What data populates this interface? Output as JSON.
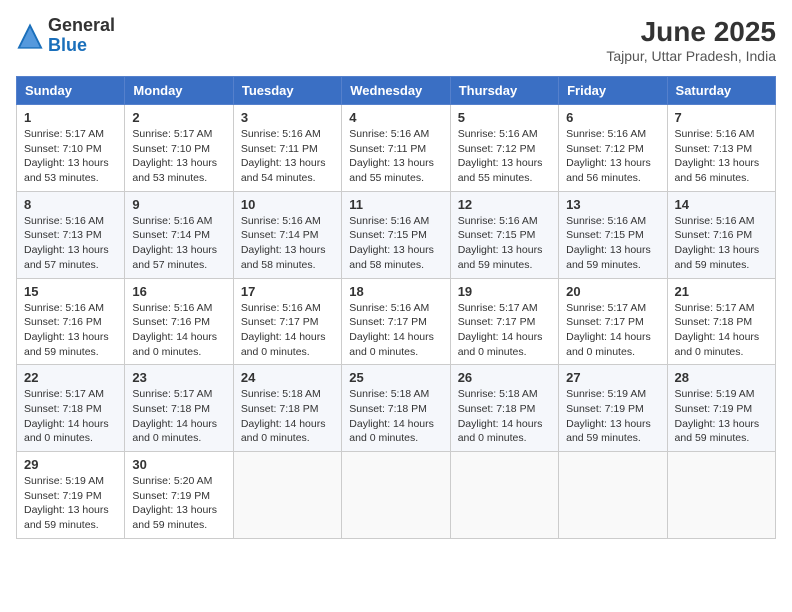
{
  "header": {
    "logo_general": "General",
    "logo_blue": "Blue",
    "month_year": "June 2025",
    "location": "Tajpur, Uttar Pradesh, India"
  },
  "days_of_week": [
    "Sunday",
    "Monday",
    "Tuesday",
    "Wednesday",
    "Thursday",
    "Friday",
    "Saturday"
  ],
  "weeks": [
    [
      {
        "day": "1",
        "lines": [
          "Sunrise: 5:17 AM",
          "Sunset: 7:10 PM",
          "Daylight: 13 hours",
          "and 53 minutes."
        ]
      },
      {
        "day": "2",
        "lines": [
          "Sunrise: 5:17 AM",
          "Sunset: 7:10 PM",
          "Daylight: 13 hours",
          "and 53 minutes."
        ]
      },
      {
        "day": "3",
        "lines": [
          "Sunrise: 5:16 AM",
          "Sunset: 7:11 PM",
          "Daylight: 13 hours",
          "and 54 minutes."
        ]
      },
      {
        "day": "4",
        "lines": [
          "Sunrise: 5:16 AM",
          "Sunset: 7:11 PM",
          "Daylight: 13 hours",
          "and 55 minutes."
        ]
      },
      {
        "day": "5",
        "lines": [
          "Sunrise: 5:16 AM",
          "Sunset: 7:12 PM",
          "Daylight: 13 hours",
          "and 55 minutes."
        ]
      },
      {
        "day": "6",
        "lines": [
          "Sunrise: 5:16 AM",
          "Sunset: 7:12 PM",
          "Daylight: 13 hours",
          "and 56 minutes."
        ]
      },
      {
        "day": "7",
        "lines": [
          "Sunrise: 5:16 AM",
          "Sunset: 7:13 PM",
          "Daylight: 13 hours",
          "and 56 minutes."
        ]
      }
    ],
    [
      {
        "day": "8",
        "lines": [
          "Sunrise: 5:16 AM",
          "Sunset: 7:13 PM",
          "Daylight: 13 hours",
          "and 57 minutes."
        ]
      },
      {
        "day": "9",
        "lines": [
          "Sunrise: 5:16 AM",
          "Sunset: 7:14 PM",
          "Daylight: 13 hours",
          "and 57 minutes."
        ]
      },
      {
        "day": "10",
        "lines": [
          "Sunrise: 5:16 AM",
          "Sunset: 7:14 PM",
          "Daylight: 13 hours",
          "and 58 minutes."
        ]
      },
      {
        "day": "11",
        "lines": [
          "Sunrise: 5:16 AM",
          "Sunset: 7:15 PM",
          "Daylight: 13 hours",
          "and 58 minutes."
        ]
      },
      {
        "day": "12",
        "lines": [
          "Sunrise: 5:16 AM",
          "Sunset: 7:15 PM",
          "Daylight: 13 hours",
          "and 59 minutes."
        ]
      },
      {
        "day": "13",
        "lines": [
          "Sunrise: 5:16 AM",
          "Sunset: 7:15 PM",
          "Daylight: 13 hours",
          "and 59 minutes."
        ]
      },
      {
        "day": "14",
        "lines": [
          "Sunrise: 5:16 AM",
          "Sunset: 7:16 PM",
          "Daylight: 13 hours",
          "and 59 minutes."
        ]
      }
    ],
    [
      {
        "day": "15",
        "lines": [
          "Sunrise: 5:16 AM",
          "Sunset: 7:16 PM",
          "Daylight: 13 hours",
          "and 59 minutes."
        ]
      },
      {
        "day": "16",
        "lines": [
          "Sunrise: 5:16 AM",
          "Sunset: 7:16 PM",
          "Daylight: 14 hours",
          "and 0 minutes."
        ]
      },
      {
        "day": "17",
        "lines": [
          "Sunrise: 5:16 AM",
          "Sunset: 7:17 PM",
          "Daylight: 14 hours",
          "and 0 minutes."
        ]
      },
      {
        "day": "18",
        "lines": [
          "Sunrise: 5:16 AM",
          "Sunset: 7:17 PM",
          "Daylight: 14 hours",
          "and 0 minutes."
        ]
      },
      {
        "day": "19",
        "lines": [
          "Sunrise: 5:17 AM",
          "Sunset: 7:17 PM",
          "Daylight: 14 hours",
          "and 0 minutes."
        ]
      },
      {
        "day": "20",
        "lines": [
          "Sunrise: 5:17 AM",
          "Sunset: 7:17 PM",
          "Daylight: 14 hours",
          "and 0 minutes."
        ]
      },
      {
        "day": "21",
        "lines": [
          "Sunrise: 5:17 AM",
          "Sunset: 7:18 PM",
          "Daylight: 14 hours",
          "and 0 minutes."
        ]
      }
    ],
    [
      {
        "day": "22",
        "lines": [
          "Sunrise: 5:17 AM",
          "Sunset: 7:18 PM",
          "Daylight: 14 hours",
          "and 0 minutes."
        ]
      },
      {
        "day": "23",
        "lines": [
          "Sunrise: 5:17 AM",
          "Sunset: 7:18 PM",
          "Daylight: 14 hours",
          "and 0 minutes."
        ]
      },
      {
        "day": "24",
        "lines": [
          "Sunrise: 5:18 AM",
          "Sunset: 7:18 PM",
          "Daylight: 14 hours",
          "and 0 minutes."
        ]
      },
      {
        "day": "25",
        "lines": [
          "Sunrise: 5:18 AM",
          "Sunset: 7:18 PM",
          "Daylight: 14 hours",
          "and 0 minutes."
        ]
      },
      {
        "day": "26",
        "lines": [
          "Sunrise: 5:18 AM",
          "Sunset: 7:18 PM",
          "Daylight: 14 hours",
          "and 0 minutes."
        ]
      },
      {
        "day": "27",
        "lines": [
          "Sunrise: 5:19 AM",
          "Sunset: 7:19 PM",
          "Daylight: 13 hours",
          "and 59 minutes."
        ]
      },
      {
        "day": "28",
        "lines": [
          "Sunrise: 5:19 AM",
          "Sunset: 7:19 PM",
          "Daylight: 13 hours",
          "and 59 minutes."
        ]
      }
    ],
    [
      {
        "day": "29",
        "lines": [
          "Sunrise: 5:19 AM",
          "Sunset: 7:19 PM",
          "Daylight: 13 hours",
          "and 59 minutes."
        ]
      },
      {
        "day": "30",
        "lines": [
          "Sunrise: 5:20 AM",
          "Sunset: 7:19 PM",
          "Daylight: 13 hours",
          "and 59 minutes."
        ]
      },
      {
        "day": "",
        "lines": []
      },
      {
        "day": "",
        "lines": []
      },
      {
        "day": "",
        "lines": []
      },
      {
        "day": "",
        "lines": []
      },
      {
        "day": "",
        "lines": []
      }
    ]
  ]
}
